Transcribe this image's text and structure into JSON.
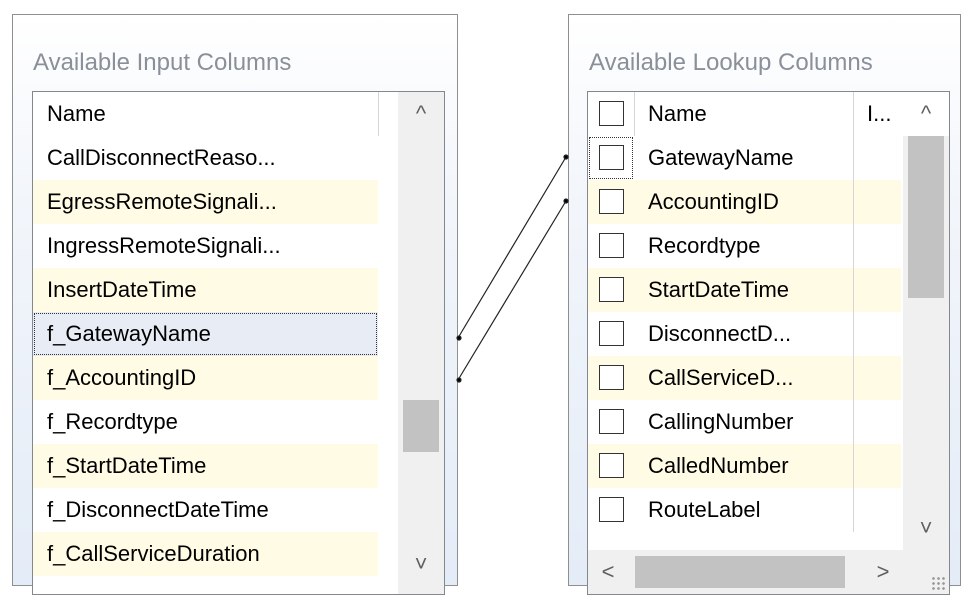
{
  "input_panel": {
    "title": "Available Input Columns",
    "header": "Name",
    "rows": [
      "CallDisconnectReaso...",
      "EgressRemoteSignali...",
      "IngressRemoteSignali...",
      "InsertDateTime",
      "f_GatewayName",
      "f_AccountingID",
      "f_Recordtype",
      "f_StartDateTime",
      "f_DisconnectDateTime",
      "f_CallServiceDuration"
    ],
    "selected_index": 4
  },
  "lookup_panel": {
    "title": "Available Lookup Columns",
    "header_name": "Name",
    "header_col2": "I...",
    "rows": [
      "GatewayName",
      "AccountingID",
      "Recordtype",
      "StartDateTime",
      "DisconnectD...",
      "CallServiceD...",
      "CallingNumber",
      "CalledNumber",
      "RouteLabel"
    ]
  },
  "scroll": {
    "up": "^",
    "down": "˅",
    "left": "<",
    "right": ">"
  }
}
